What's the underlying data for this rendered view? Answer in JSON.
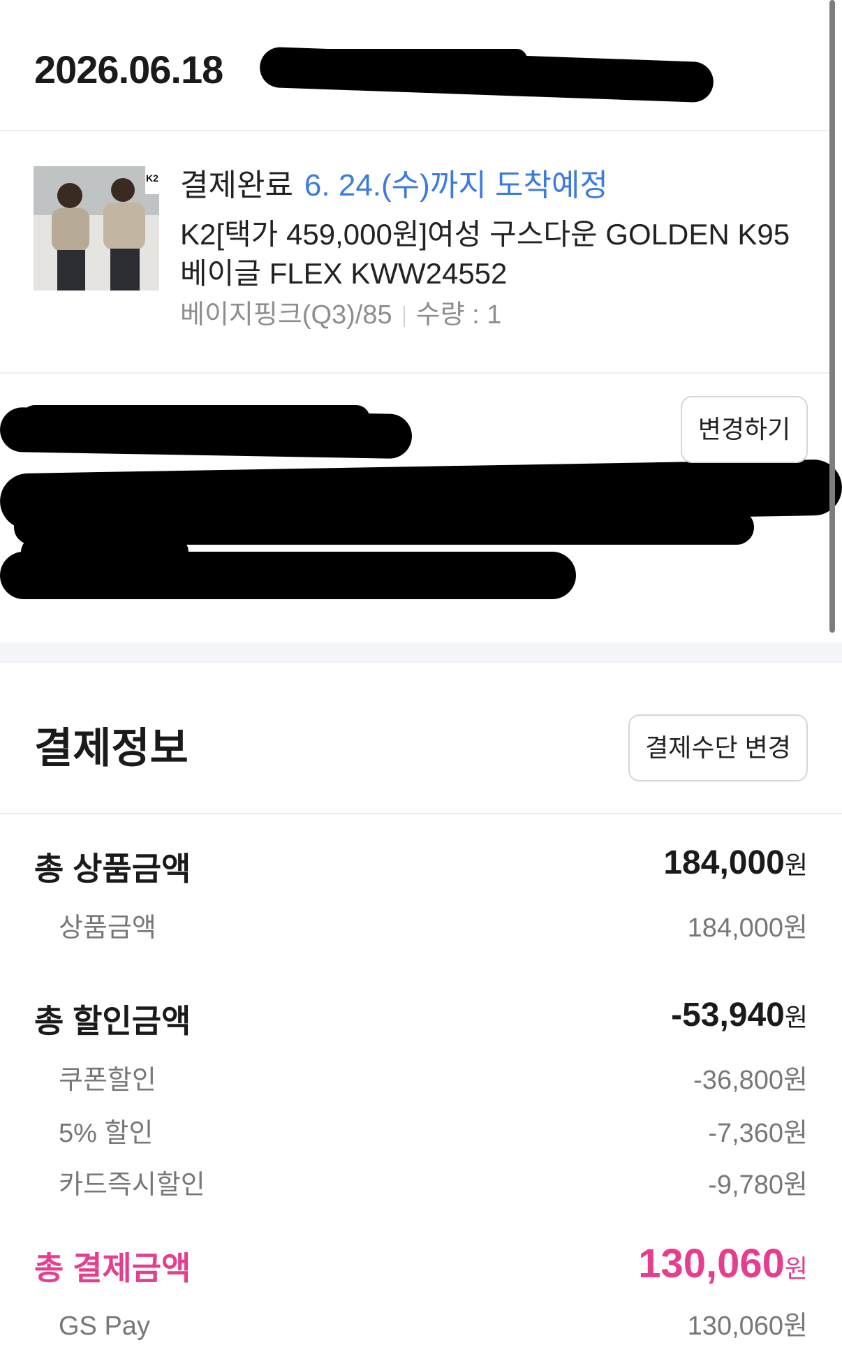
{
  "order": {
    "date": "2026.06.18"
  },
  "product": {
    "status": "결제완료",
    "arrival": "6. 24.(수)까지 도착예정",
    "name": "K2[택가 459,000원]여성 구스다운 GOLDEN K95 베이글 FLEX KWW24552",
    "option": "베이지핑크(Q3)/85",
    "quantity": "수량 : 1",
    "thumb_badge": "K2"
  },
  "shipping": {
    "change_button": "변경하기"
  },
  "payment": {
    "title": "결제정보",
    "change_method_button": "결제수단 변경",
    "currency_unit": "원",
    "total_product": {
      "label": "총 상품금액",
      "value": "184,000"
    },
    "product_amount": {
      "label": "상품금액",
      "value": "184,000원"
    },
    "total_discount": {
      "label": "총 할인금액",
      "value": "-53,940"
    },
    "discounts": [
      {
        "label": "쿠폰할인",
        "value": "-36,800원"
      },
      {
        "label": "5% 할인",
        "value": "-7,360원"
      },
      {
        "label": "카드즉시할인",
        "value": "-9,780원"
      }
    ],
    "total_payment": {
      "label": "총 결제금액",
      "value": "130,060"
    },
    "method": {
      "label": "GS Pay",
      "value": "130,060원"
    }
  },
  "colors": {
    "accent_blue": "#3a7be0",
    "accent_pink": "#e53e8e",
    "muted": "#8e8e8e"
  }
}
